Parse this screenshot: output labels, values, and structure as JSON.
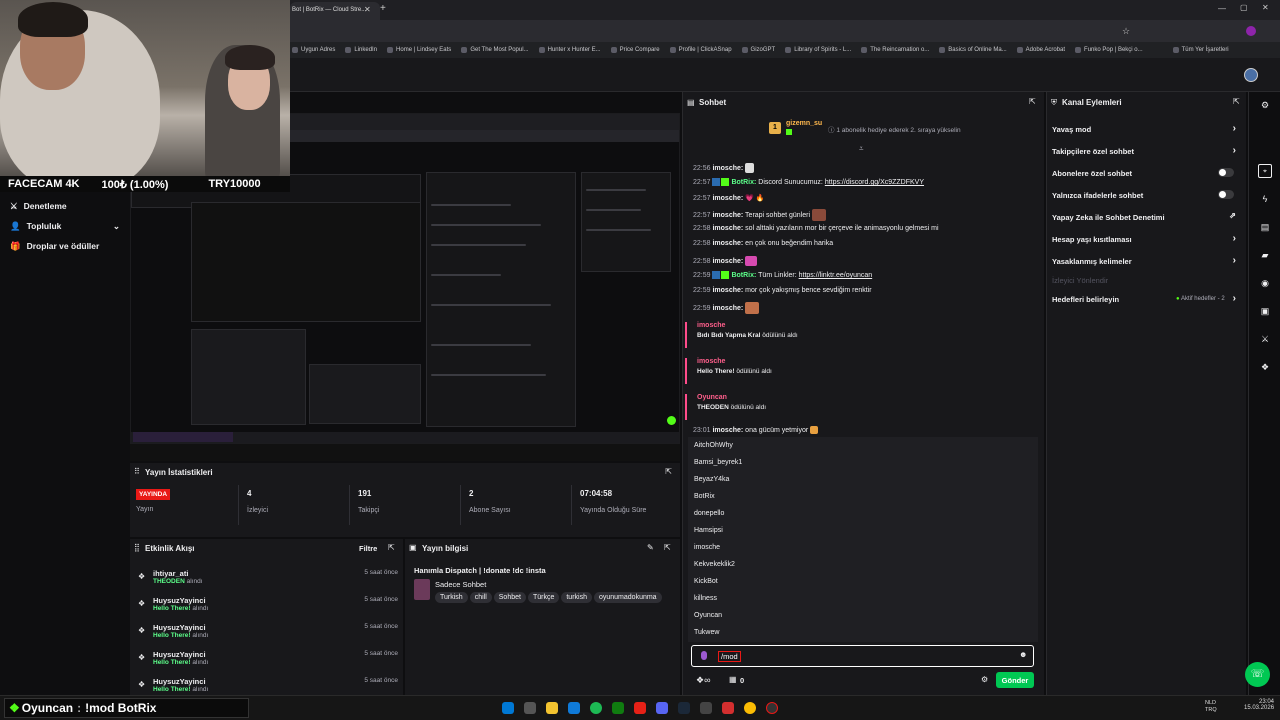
{
  "browser": {
    "tab_title": "Bot | BotRix — Cloud Stre...",
    "bookmarks": [
      "Uygun Adres",
      "LinkedIn",
      "Home | Lindsey Eats",
      "Get The Most Popul...",
      "Hunter x Hunter E...",
      "Price Compare",
      "Profile | ClickASnap",
      "GizoGPT",
      "Library of Spirits - L...",
      "The Reincarnation o...",
      "Basics of Online Ma...",
      "Adobe Acrobat",
      "Funko Pop | Bekçi o...",
      "Tüm Yer İşaretleri"
    ]
  },
  "webcam": {
    "label_left": "FACECAM 4K",
    "label_mid": "100₺ (1.00%)",
    "label_right": "TRY10000"
  },
  "left_nav": [
    {
      "label": "Denetleme",
      "icon": "sword-icon"
    },
    {
      "label": "Topluluk",
      "icon": "user-icon",
      "chevron": "⌄"
    },
    {
      "label": "Droplar ve ödüller",
      "icon": "gift-icon"
    }
  ],
  "stats": {
    "title": "Yayın İstatistikleri",
    "live_badge": "YAYINDA",
    "items": [
      {
        "value": "",
        "label": "Yayın"
      },
      {
        "value": "4",
        "label": "İzleyici"
      },
      {
        "value": "191",
        "label": "Takipçi"
      },
      {
        "value": "2",
        "label": "Abone Sayısı"
      },
      {
        "value": "07:04:58",
        "label": "Yayında Olduğu Süre"
      }
    ]
  },
  "activity": {
    "title": "Etkinlik Akışı",
    "filter": "Filtre",
    "items": [
      {
        "user": "ihtiyar_ati",
        "reward": "THEODEN",
        "suffix": "alındı",
        "time": "5 saat önce"
      },
      {
        "user": "HuysuzYayinci",
        "reward": "Hello There!",
        "suffix": "alındı",
        "time": "5 saat önce"
      },
      {
        "user": "HuysuzYayinci",
        "reward": "Hello There!",
        "suffix": "alındı",
        "time": "5 saat önce"
      },
      {
        "user": "HuysuzYayinci",
        "reward": "Hello There!",
        "suffix": "alındı",
        "time": "5 saat önce"
      },
      {
        "user": "HuysuzYayinci",
        "reward": "Hello There!",
        "suffix": "alındı",
        "time": "5 saat önce"
      }
    ]
  },
  "stream_info": {
    "title": "Yayın bilgisi",
    "stream_title": "Hanımla Dispatch | !donate !dc !insta",
    "category": "Sadece Sohbet",
    "tags": [
      "Turkish",
      "chill",
      "Sohbet",
      "Türkçe",
      "turkish",
      "oyunumadokunma"
    ]
  },
  "chat": {
    "title": "Sohbet",
    "pinned_user": "gizemn_su",
    "pinned_count": "1",
    "pinned_text": "1 abonelik hediye ederek 2. sıraya yükselin",
    "messages": [
      {
        "time": "22:56",
        "user": "imosche:",
        "text": "",
        "color": "#efeff1"
      },
      {
        "time": "22:57",
        "user": "BotRix:",
        "text": "Discord Sunucumuz: ",
        "link": "https://discord.gg/Xc9ZZDFKVY",
        "color": "#5cff8a"
      },
      {
        "time": "22:57",
        "user": "imosche:",
        "text": "💗 🔥",
        "color": "#efeff1"
      },
      {
        "time": "22:57",
        "user": "imosche:",
        "text": "Terapi sohbet günleri",
        "color": "#efeff1"
      },
      {
        "time": "22:58",
        "user": "imosche:",
        "text": "sol alttaki yazıların mor bir çerçeve ile animasyonlu gelmesi mi",
        "color": "#efeff1"
      },
      {
        "time": "22:58",
        "user": "imosche:",
        "text": "en çok onu beğendim harika",
        "color": "#efeff1"
      },
      {
        "time": "22:58",
        "user": "imosche:",
        "text": "",
        "color": "#efeff1"
      },
      {
        "time": "22:59",
        "user": "BotRix:",
        "text": "Tüm Linkler: ",
        "link": "https://linktr.ee/oyuncan",
        "color": "#5cff8a"
      },
      {
        "time": "22:59",
        "user": "imosche:",
        "text": "mor çok yakışmış bence sevdiğim renktir",
        "color": "#efeff1"
      },
      {
        "time": "22:59",
        "user": "imosche:",
        "text": "",
        "color": "#efeff1"
      }
    ],
    "redeems": [
      {
        "user": "imosche",
        "reward": "Bıdı Bıdı Yapma Kral",
        "suffix": "ödülünü aldı"
      },
      {
        "user": "imosche",
        "reward": "Hello There!",
        "suffix": "ödülünü aldı"
      },
      {
        "user": "Oyuncan",
        "reward": "THEODEN",
        "suffix": "ödülünü aldı"
      }
    ],
    "last_message": {
      "time": "23:01",
      "user": "imosche:",
      "text": "ona gücüm yetmiyor"
    },
    "mention_list": [
      "AitchOhWhy",
      "Bamsi_beyrek1",
      "BeyazY4ka",
      "BotRix",
      "donepello",
      "Hamsipsi",
      "imosche",
      "Kekvekeklik2",
      "KickBot",
      "killness",
      "Oyuncan",
      "Tukwew"
    ],
    "input_value": "/mod",
    "footer_count": "0",
    "send_label": "Gönder"
  },
  "channel_actions": {
    "title": "Kanal Eylemleri",
    "rows": [
      {
        "label": "Yavaş mod",
        "control": "chevron"
      },
      {
        "label": "Takipçilere özel sohbet",
        "control": "chevron"
      },
      {
        "label": "Abonelere özel sohbet",
        "control": "toggle"
      },
      {
        "label": "Yalnızca ifadelerle sohbet",
        "control": "toggle"
      },
      {
        "label": "Yapay Zeka ile Sohbet Denetimi",
        "control": "external"
      },
      {
        "label": "Hesap yaşı kısıtlaması",
        "control": "chevron"
      },
      {
        "label": "Yasaklanmış kelimeler",
        "control": "chevron"
      },
      {
        "label": "İzleyici Yönlendir",
        "control": "none",
        "muted": true
      },
      {
        "label": "Hedefleri belirleyin",
        "control": "chevron",
        "badge": "Aktif hedefler - 2"
      }
    ]
  },
  "overlay_bottom": {
    "text": "Oyuncan",
    "command": "!mod BotRix"
  },
  "taskbar": {
    "lang": "NLD\nTRQ",
    "time": "23:04",
    "date": "15.03.2026"
  },
  "colors": {
    "kick_green": "#53fc18",
    "accent_green": "#00c853",
    "live_red": "#e91916",
    "redeem_pink": "#ff4c8b"
  }
}
